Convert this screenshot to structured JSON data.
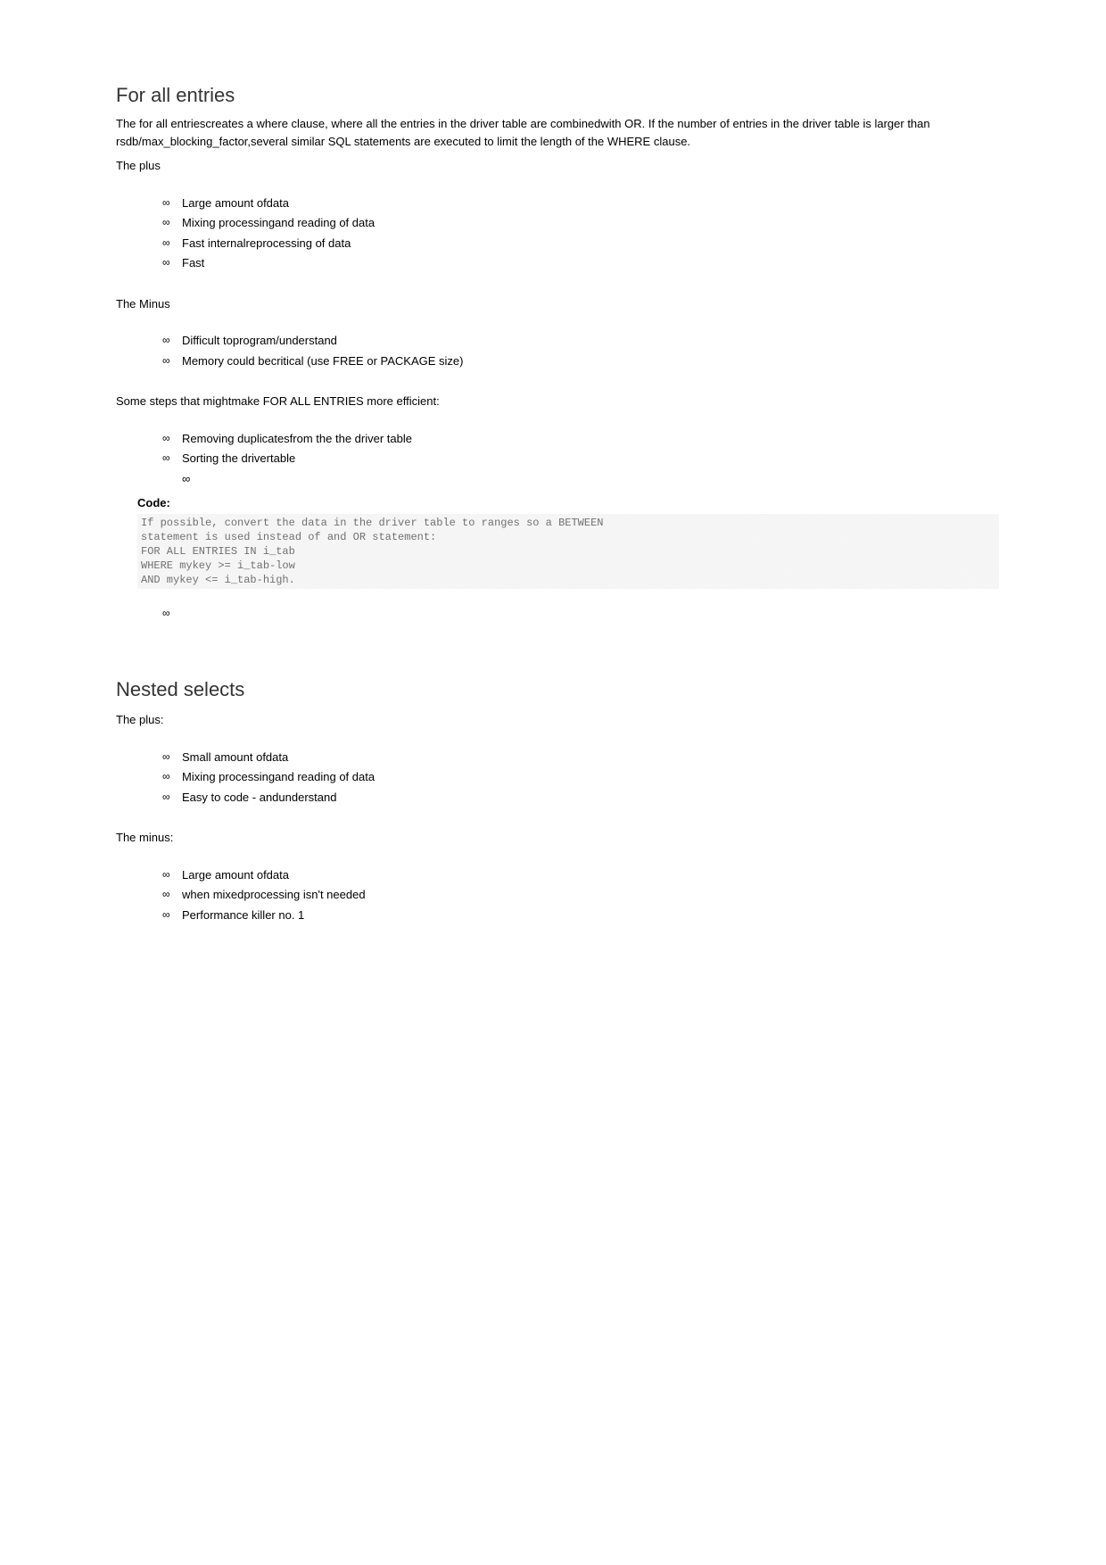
{
  "section1": {
    "heading": "For all entries",
    "intro": "The for all entriescreates a where clause, where all the entries in the driver table are combinedwith OR. If the number of entries in the driver table is larger than rsdb/max_blocking_factor,several similar SQL statements are executed to limit the length of the WHERE clause.",
    "plus_label": "The plus",
    "plus_items": [
      "Large amount ofdata",
      "Mixing processingand reading of data",
      "Fast internalreprocessing of data",
      "Fast"
    ],
    "minus_label": "The Minus",
    "minus_items": [
      "Difficult toprogram/understand",
      "Memory could becritical (use FREE or PACKAGE size)"
    ],
    "steps_label": "Some steps that mightmake FOR ALL ENTRIES more efficient:",
    "steps_items": [
      "Removing duplicatesfrom the the driver table",
      "Sorting the drivertable"
    ],
    "code_label": "Code:",
    "code": "If possible, convert the data in the driver table to ranges so a BETWEEN\nstatement is used instead of and OR statement:\nFOR ALL ENTRIES IN i_tab\nWHERE mykey >= i_tab-low\nAND mykey <= i_tab-high."
  },
  "section2": {
    "heading": "Nested selects",
    "plus_label": "The plus:",
    "plus_items": [
      "Small amount ofdata",
      "Mixing processingand reading of data",
      "Easy to code - andunderstand"
    ],
    "minus_label": "The minus:",
    "minus_items": [
      "Large amount ofdata",
      "when mixedprocessing isn't needed",
      "Performance killer no. 1"
    ]
  }
}
